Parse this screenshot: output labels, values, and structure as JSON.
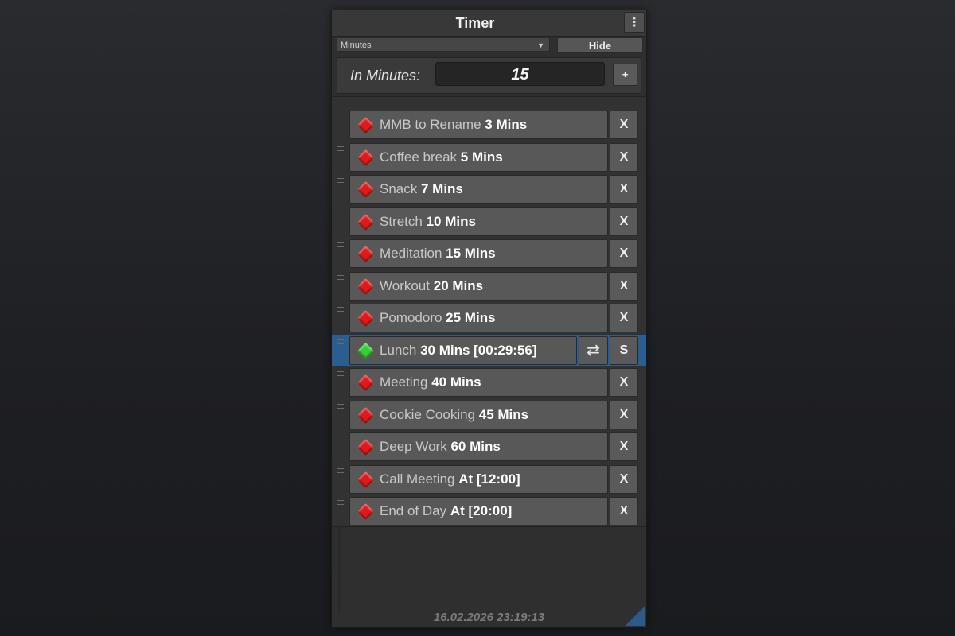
{
  "window": {
    "title": "Timer",
    "menu_icon": "vertical-ellipsis-icon",
    "menu_glyph": "⋮"
  },
  "toolbar": {
    "mode_selected": "Minutes",
    "hide_label": "Hide"
  },
  "minutes_input": {
    "label": "In Minutes:",
    "value": "15",
    "add_label": "+"
  },
  "timers": [
    {
      "name": "MMB to Rename",
      "duration": "3 Mins",
      "status": "red"
    },
    {
      "name": "Coffee break",
      "duration": "5 Mins",
      "status": "red"
    },
    {
      "name": "Snack",
      "duration": "7 Mins",
      "status": "red"
    },
    {
      "name": "Stretch",
      "duration": "10 Mins",
      "status": "red"
    },
    {
      "name": "Meditation",
      "duration": "15 Mins",
      "status": "red"
    },
    {
      "name": "Workout",
      "duration": "20 Mins",
      "status": "red"
    },
    {
      "name": "Pomodoro",
      "duration": "25 Mins",
      "status": "red"
    },
    {
      "name": "Lunch",
      "duration": "30 Mins [00:29:56]",
      "status": "green",
      "active": true,
      "repeat_glyph": "⇄",
      "action_label": "S"
    },
    {
      "name": "Meeting",
      "duration": "40 Mins",
      "status": "red"
    },
    {
      "name": "Cookie Cooking",
      "duration": "45 Mins",
      "status": "red"
    },
    {
      "name": "Deep Work",
      "duration": "60 Mins",
      "status": "red"
    },
    {
      "name": "Call Meeting",
      "duration": "At [12:00]",
      "status": "red"
    },
    {
      "name": "End of Day",
      "duration": "At [20:00]",
      "status": "red"
    }
  ],
  "remove_label": "X",
  "footer": {
    "datetime": "16.02.2026 23:19:13"
  },
  "colors": {
    "selected_row": "#2c5d8f",
    "status_red": "#e01a1a",
    "status_green": "#36d12f"
  }
}
